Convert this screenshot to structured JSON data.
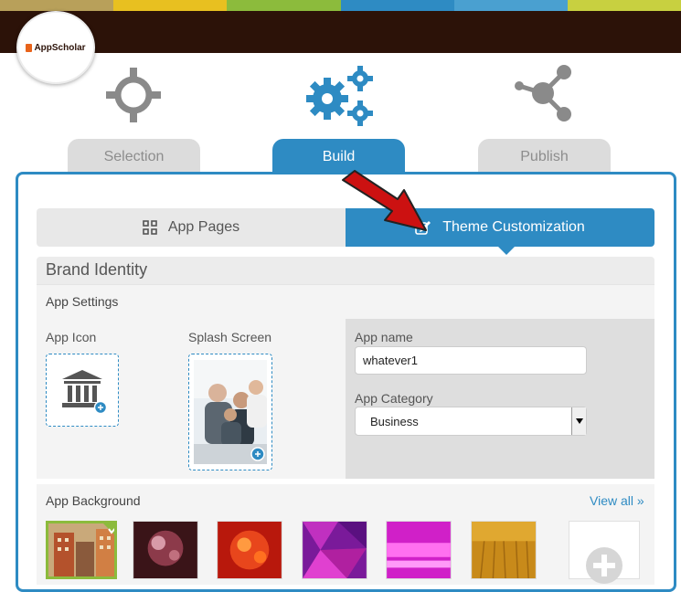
{
  "brand": {
    "logo_text": "AppScholar"
  },
  "steps": [
    {
      "label": "Selection",
      "icon": "crosshair-icon",
      "state": "inactive"
    },
    {
      "label": "Build",
      "icon": "gears-icon",
      "state": "active"
    },
    {
      "label": "Publish",
      "icon": "share-icon",
      "state": "inactive"
    }
  ],
  "subtabs": {
    "app_pages": {
      "label": "App Pages",
      "icon": "grid-icon"
    },
    "theme": {
      "label": "Theme Customization",
      "icon": "edit-icon"
    }
  },
  "brand_identity": {
    "title": "Brand Identity"
  },
  "app_settings": {
    "title": "App Settings",
    "app_icon_label": "App Icon",
    "splash_label": "Splash Screen",
    "app_name_label": "App name",
    "app_name_value": "whatever1",
    "category_label": "App Category",
    "category_value": "Business"
  },
  "background": {
    "title": "App Background",
    "view_all": "View all »",
    "selected_index": 0
  },
  "colors": {
    "accent": "#2e8bc3",
    "topbar": "#2c1208",
    "stripe": [
      "#b8a05a",
      "#e8c020",
      "#8cbb3c",
      "#2e8bc3",
      "#c8d040"
    ],
    "arrow": "#cc1111"
  }
}
